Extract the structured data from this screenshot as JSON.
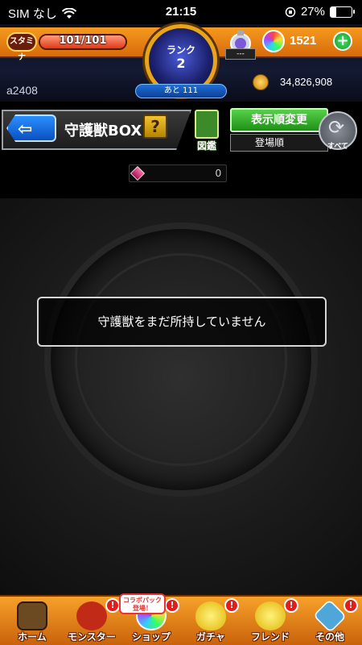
{
  "status_bar": {
    "carrier": "SIM なし",
    "time": "21:15",
    "battery_percent": "27%",
    "battery_level": 0.27
  },
  "header": {
    "stamina_label": "スタミナ",
    "stamina_text": "101/101",
    "stamina_fraction": 1.0,
    "rank_label": "ランク",
    "rank_value": "2",
    "xp_remaining": "あと 111",
    "orb_shop_sub": "---",
    "orbs": "1521",
    "username": "a2408",
    "coins": "34,826,908"
  },
  "titlebar": {
    "title": "守護獣BOX",
    "help_label": "?",
    "zukan_label": "図鑑",
    "sort_button_label": "表示順変更",
    "sort_value": "登場順",
    "reset_label": "すべて"
  },
  "count": {
    "value": "0"
  },
  "main": {
    "empty_message": "守護獣をまだ所持していません"
  },
  "nav": {
    "items": [
      {
        "label": "ホーム",
        "icon": "castle-icon",
        "color": "#6b4a22"
      },
      {
        "label": "モンスター",
        "icon": "monster-icon",
        "color": "#c22a18",
        "badge": "!"
      },
      {
        "label": "ショップ",
        "icon": "rainbow-orb-icon",
        "color": "#ffffff",
        "badge": "!"
      },
      {
        "label": "ガチャ",
        "icon": "egg-icon",
        "color": "#f2d41c",
        "badge": "!"
      },
      {
        "label": "フレンド",
        "icon": "friends-icon",
        "color": "#f2d41c",
        "badge": "!"
      },
      {
        "label": "その他",
        "icon": "other-icon",
        "color": "#4fa6d8",
        "badge": "!"
      }
    ],
    "collab_tag": "コラボパック登場！"
  }
}
